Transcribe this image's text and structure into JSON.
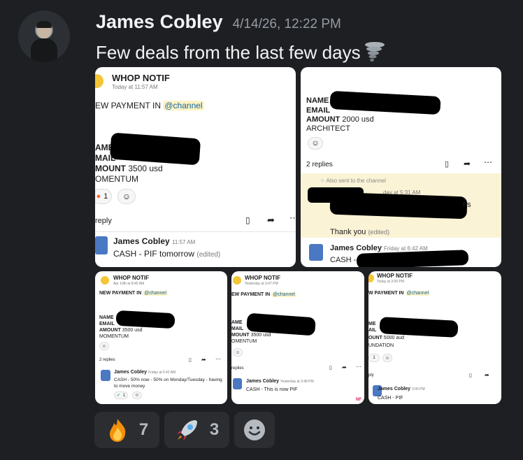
{
  "message": {
    "author": "James Cobley",
    "timestamp": "4/14/26, 12:22 PM",
    "text": "Few deals from the last few days",
    "emoji": "tornado"
  },
  "card1": {
    "title": "WHOP NOTIF",
    "time": "Today at 11:57 AM",
    "line": "EW PAYMENT IN",
    "mention": "@channel",
    "f1": "AME",
    "f2": "MAIL",
    "f3": "MOUNT",
    "amount": "3500 usd",
    "product": "OMENTUM",
    "reaction_count": "1",
    "reply": "reply",
    "reply_author": "James Cobley",
    "reply_time": "11:57 AM",
    "reply_text": "CASH - PIF tomorrow",
    "edited": "(edited)"
  },
  "card2": {
    "f1": "NAME",
    "f2": "EMAIL",
    "f3": "AMOUNT",
    "amount": "2000 usd",
    "product": "ARCHITECT",
    "replies": "2 replies",
    "sent_to": "Also sent to the channel",
    "partial_time": "day at 5:31 AM",
    "partial_right": "ris",
    "thanks": "Thank you",
    "edited": "(edited)",
    "reply_author": "James Cobley",
    "reply_time": "Friday at 6:42 AM",
    "reply_text": "CASH -"
  },
  "card3": {
    "title": "WHOP NOTIF",
    "time": "Apr 10th at 8:45 AM",
    "line": "NEW PAYMENT IN",
    "mention": "@channel",
    "f1": "NAME",
    "f2": "EMAIL",
    "f3": "AMOUNT",
    "amount": "3500 usd",
    "product": "MOMENTUM",
    "replies": "2 replies",
    "reply_author": "James Cobley",
    "reply_time": "Friday at 6:42 AM",
    "reply_text": "CASH - 50% now - 50% on Monday/Tuesday - having to move money",
    "reaction_count": "1"
  },
  "card4": {
    "title": "WHOP NOTIF",
    "time": "Yesterday at 3:47 PM",
    "line": "EW PAYMENT IN",
    "mention": "@channel",
    "f1": "AME",
    "f2": "MAIL",
    "f3": "MOUNT",
    "amount": "3500 usd",
    "product": "OMENTUM",
    "replies": "replies",
    "reply_author": "James Cobley",
    "reply_time": "Yesterday at 3:48 PM",
    "reply_text": "CASH - This is now PIF",
    "corner": "NF"
  },
  "card5": {
    "title": "WHOP NOTIF",
    "time": "Today at 3:00 PM",
    "line": "W PAYMENT IN",
    "mention": "@channel",
    "f1": "ME",
    "f2": "AIL",
    "f3": "OUNT",
    "amount": "5000 aud",
    "product": "UNDATION",
    "reaction_count": "1",
    "replies": "ply",
    "reply_author": "James Cobley",
    "reply_time": "3:00 PM",
    "reply_text": "CASH - PIF"
  },
  "reactions": [
    {
      "emoji": "fire",
      "count": "7"
    },
    {
      "emoji": "rocket",
      "count": "3"
    },
    {
      "emoji": "add-reaction",
      "count": ""
    }
  ],
  "colors": {
    "background": "#1e1f22",
    "reaction_bg": "#2b2d31",
    "muted": "#949ba4"
  }
}
